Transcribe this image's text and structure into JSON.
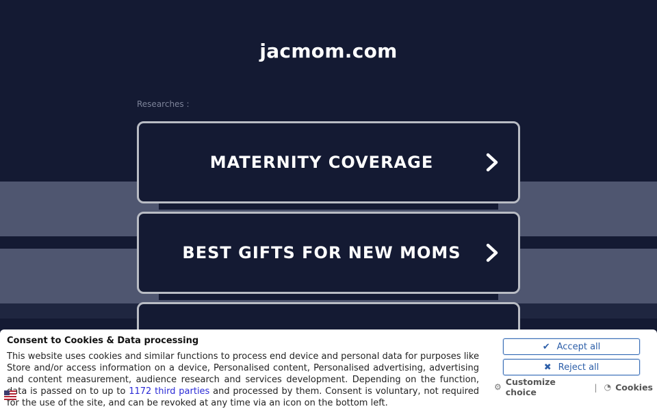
{
  "site": {
    "title": "jacmom.com"
  },
  "main": {
    "researches_label": "Researches :",
    "links": [
      {
        "label": "MATERNITY COVERAGE"
      },
      {
        "label": "BEST GIFTS FOR NEW MOMS"
      },
      {
        "label": ""
      }
    ]
  },
  "consent": {
    "title": "Consent to Cookies & Data processing",
    "text_before": "This website uses cookies and similar functions to process end device and personal data for purposes like Store and/or access information on a device, Personalised content, Personalised advertising, advertising and content measurement, audience research and services development. Depending on the function, data is passed on to up to ",
    "third_parties_link": "1172 third parties",
    "text_after": " and processed by them. Consent is voluntary, not required for the use of the site, and can be revoked at any time via an icon on the bottom left.",
    "accept_label": "Accept all",
    "reject_label": "Reject all",
    "customize_label": "Customize choice",
    "cookies_label": "Cookies"
  },
  "icons": {
    "chevron": "chevron-right-icon",
    "accept": "check-icon",
    "reject": "x-icon",
    "customize": "gear-icon",
    "cookies": "cookie-icon",
    "language": "language-icon"
  },
  "colors": {
    "background": "#141a33",
    "band": "#4f5670",
    "card_border": "#b9bcc4",
    "button_text": "#2c5ea8",
    "link": "#2a2ad6"
  }
}
